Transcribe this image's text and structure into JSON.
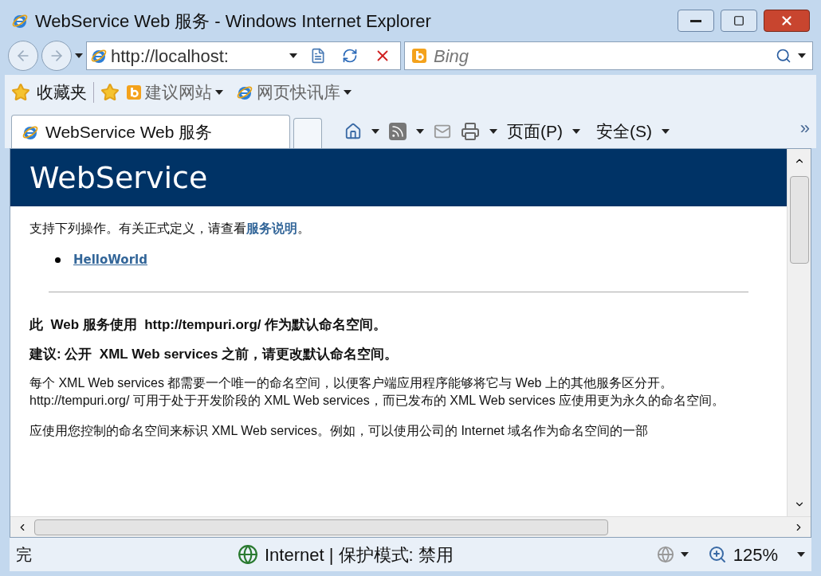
{
  "window": {
    "title": "WebService Web 服务 - Windows Internet Explorer"
  },
  "address_bar": {
    "value": "http://localhost:"
  },
  "search": {
    "placeholder": "Bing"
  },
  "favorites_bar": {
    "favorites": "收藏夹",
    "items": [
      {
        "label": "建议网站"
      },
      {
        "label": "网页快讯库"
      }
    ]
  },
  "tabs": [
    {
      "label": "WebService Web 服务",
      "selected": true
    }
  ],
  "command_bar": {
    "page": "页面(P)",
    "safety": "安全(S)",
    "overflow": "»"
  },
  "page": {
    "heading": "WebService",
    "intro": {
      "before": "支持下列操作。有关正式定义，请查看",
      "link": "服务说明",
      "after": "。"
    },
    "operations": [
      "HelloWorld"
    ],
    "paragraphs": [
      {
        "kind": "bold",
        "text": "此  Web 服务使用  http://tempuri.org/ 作为默认命名空间。"
      },
      {
        "kind": "bold",
        "text": "建议: 公开  XML Web services 之前，请更改默认命名空间。"
      },
      {
        "kind": "plain",
        "text": "每个 XML Web services 都需要一个唯一的命名空间，以便客户端应用程序能够将它与 Web 上的其他服务区分开。http://tempuri.org/ 可用于处于开发阶段的 XML Web services，而已发布的 XML Web services 应使用更为永久的命名空间。"
      },
      {
        "kind": "plain",
        "text": "应使用您控制的命名空间来标识 XML Web services。例如，可以使用公司的 Internet 域名作为命名空间的一部"
      }
    ]
  },
  "status_bar": {
    "status": "完",
    "zone": "Internet | 保护模式: 禁用",
    "zoom": "125%"
  }
}
